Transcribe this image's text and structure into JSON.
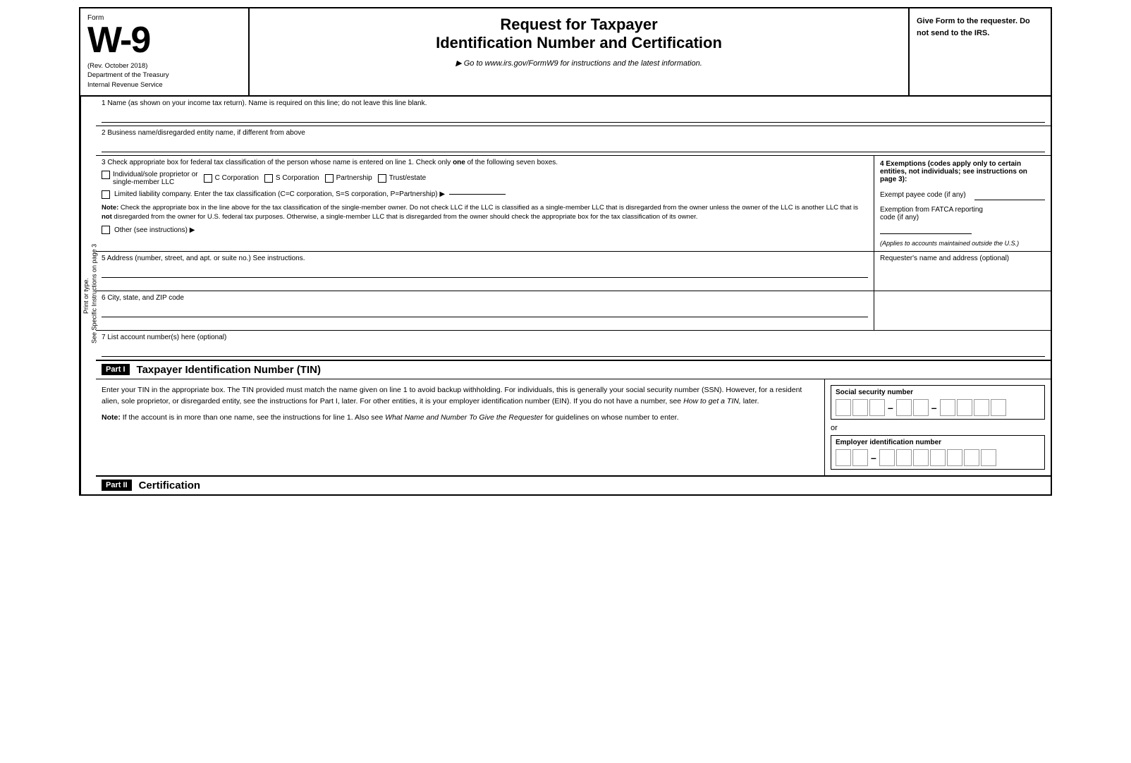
{
  "header": {
    "form_label": "Form",
    "form_number": "W-9",
    "rev_date": "(Rev. October 2018)",
    "dept": "Department of the Treasury",
    "irs": "Internal Revenue Service",
    "title_line1": "Request for Taxpayer",
    "title_line2": "Identification Number and Certification",
    "goto_text": "▶ Go to www.irs.gov/FormW9 for instructions and the latest information.",
    "right_text": "Give Form to the requester. Do not send to the IRS."
  },
  "sidebar": {
    "line1": "Print or type.",
    "line2": "See Specific Instructions on page 3"
  },
  "fields": {
    "field1_label": "1  Name (as shown on your income tax return). Name is required on this line; do not leave this line blank.",
    "field2_label": "2  Business name/disregarded entity name, if different from above",
    "field3_label": "3  Check appropriate box for federal tax classification of the person whose name is entered on line 1. Check only",
    "field3_one": "one",
    "field3_label2": "of the following seven boxes.",
    "checkbox_individual": "Individual/sole proprietor or\nsingle-member LLC",
    "checkbox_c_corp": "C Corporation",
    "checkbox_s_corp": "S Corporation",
    "checkbox_partnership": "Partnership",
    "checkbox_trust": "Trust/estate",
    "llc_label": "Limited liability company. Enter the tax classification (C=C corporation, S=S corporation, P=Partnership) ▶",
    "note_label": "Note:",
    "note_text": " Check the appropriate box in the line above for the tax classification of the single-member owner. Do not check LLC if the LLC is classified as a single-member LLC that is disregarded from the owner unless the owner of the LLC is another LLC that is",
    "note_not": " not",
    "note_text2": " disregarded from the owner for U.S. federal tax purposes. Otherwise, a single-member LLC that is disregarded from the owner should check the appropriate box for the tax classification of its owner.",
    "other_label": "Other (see instructions) ▶",
    "exemptions_title": "4  Exemptions (codes apply only to certain entities, not individuals; see instructions on page 3):",
    "exempt_payee_label": "Exempt payee code (if any)",
    "fatca_label": "Exemption from FATCA reporting\ncode (if any)",
    "fatca_applies": "(Applies to accounts maintained outside the U.S.)",
    "field5_label": "5  Address (number, street, and apt. or suite no.) See instructions.",
    "requester_label": "Requester's name and address (optional)",
    "field6_label": "6  City, state, and ZIP code",
    "field7_label": "7  List account number(s) here (optional)"
  },
  "part1": {
    "badge": "Part I",
    "title": "Taxpayer Identification Number (TIN)",
    "body_text": "Enter your TIN in the appropriate box. The TIN provided must match the name given on line 1 to avoid backup withholding. For individuals, this is generally your social security number (SSN). However, for a resident alien, sole proprietor, or disregarded entity, see the instructions for Part I, later. For other entities, it is your employer identification number (EIN). If you do not have a number, see",
    "how_get": " How to get a TIN,",
    "body_text2": " later.",
    "note_label": "Note:",
    "note_text": " If the account is in more than one name, see the instructions for line 1. Also see",
    "what_name": " What Name and Number To Give the Requester",
    "note_text2": " for guidelines on whose number to enter.",
    "ssn_label": "Social security number",
    "ssn_groups": [
      3,
      2,
      4
    ],
    "or_text": "or",
    "ein_label": "Employer identification number",
    "ein_groups": [
      2,
      7
    ]
  },
  "part2": {
    "badge": "Part II",
    "title": "Certification"
  }
}
